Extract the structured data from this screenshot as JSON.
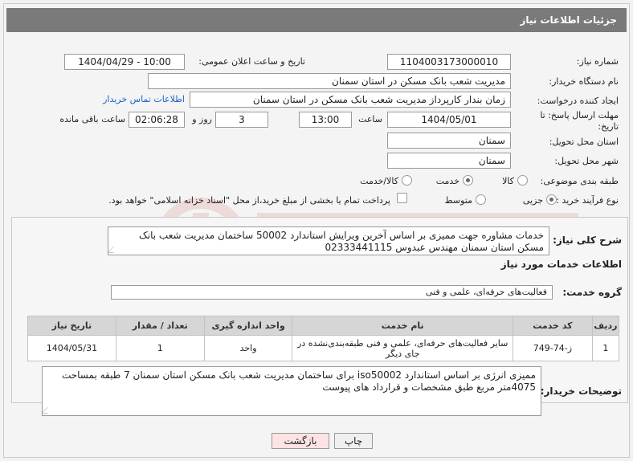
{
  "header": {
    "title": "جزئیات اطلاعات نیاز"
  },
  "fields": {
    "need_number_label": "شماره نیاز:",
    "need_number": "1104003173000010",
    "announce_label": "تاریخ و ساعت اعلان عمومی:",
    "announce_value": "1404/04/29 - 10:00",
    "buyer_org_label": "نام دستگاه خریدار:",
    "buyer_org": "مدیریت شعب بانک مسکن در استان سمنان",
    "requester_label": "ایجاد کننده درخواست:",
    "requester": "زمان بندار کارپرداز مدیریت شعب بانک مسکن در استان سمنان",
    "contact_link": "اطلاعات تماس خریدار",
    "deadline_label_1": "مهلت ارسال پاسخ: تا",
    "deadline_label_2": "تاریخ:",
    "deadline_date": "1404/05/01",
    "time_label": "ساعت",
    "deadline_time": "13:00",
    "days_value": "3",
    "days_label": "روز و",
    "remaining_time": "02:06:28",
    "remaining_label": "ساعت باقی مانده",
    "province_label": "استان محل تحویل:",
    "province": "سمنان",
    "city_label": "شهر محل تحویل:",
    "city": "سمنان",
    "category_label": "طبقه بندی موضوعی:",
    "category_options": [
      "کالا",
      "خدمت",
      "کالا/خدمت"
    ],
    "category_selected": 1,
    "process_label": "نوع فرآیند خرید :",
    "process_options": [
      "جزیی",
      "متوسط"
    ],
    "process_selected": 0,
    "payment_note": "پرداخت تمام یا بخشی از مبلغ خرید،از محل \"اسناد خزانه اسلامی\" خواهد بود."
  },
  "summary": {
    "label": "شرح کلی نیاز:",
    "text": "خدمات مشاوره جهت ممیزی بر اساس آخرین ویرایش استاندارد 50002 ساختمان مدیریت شعب بانک مسکن استان سمنان مهندس عبدوس 02333441115"
  },
  "services": {
    "section_title": "اطلاعات خدمات مورد نیاز",
    "group_label": "گروه خدمت:",
    "group_value": "فعالیت‌های حرفه‌ای، علمی و فنی",
    "columns": [
      "ردیف",
      "کد خدمت",
      "نام خدمت",
      "واحد اندازه گیری",
      "تعداد / مقدار",
      "تاریخ نیاز"
    ],
    "rows": [
      [
        "1",
        "ز-74-749",
        "سایر فعالیت‌های حرفه‌ای، علمی و فنی طبقه‌بندی‌نشده در جای دیگر",
        "واحد",
        "1",
        "1404/05/31"
      ]
    ]
  },
  "buyer_notes": {
    "label": "توضیحات خریدار:",
    "text": "ممیزی انرژی بر اساس استاندارد iso50002  برای ساختمان مدیریت شعب بانک مسکن استان سمنان 7 طبقه بمساحت 4075متر مربع طبق مشخصات و قرارداد های پیوست"
  },
  "buttons": {
    "print": "چاپ",
    "back": "بازگشت"
  },
  "colors": {
    "header_bg": "#7a7a7a",
    "link": "#1a62c9",
    "back_btn_bg": "#fde3e3"
  }
}
